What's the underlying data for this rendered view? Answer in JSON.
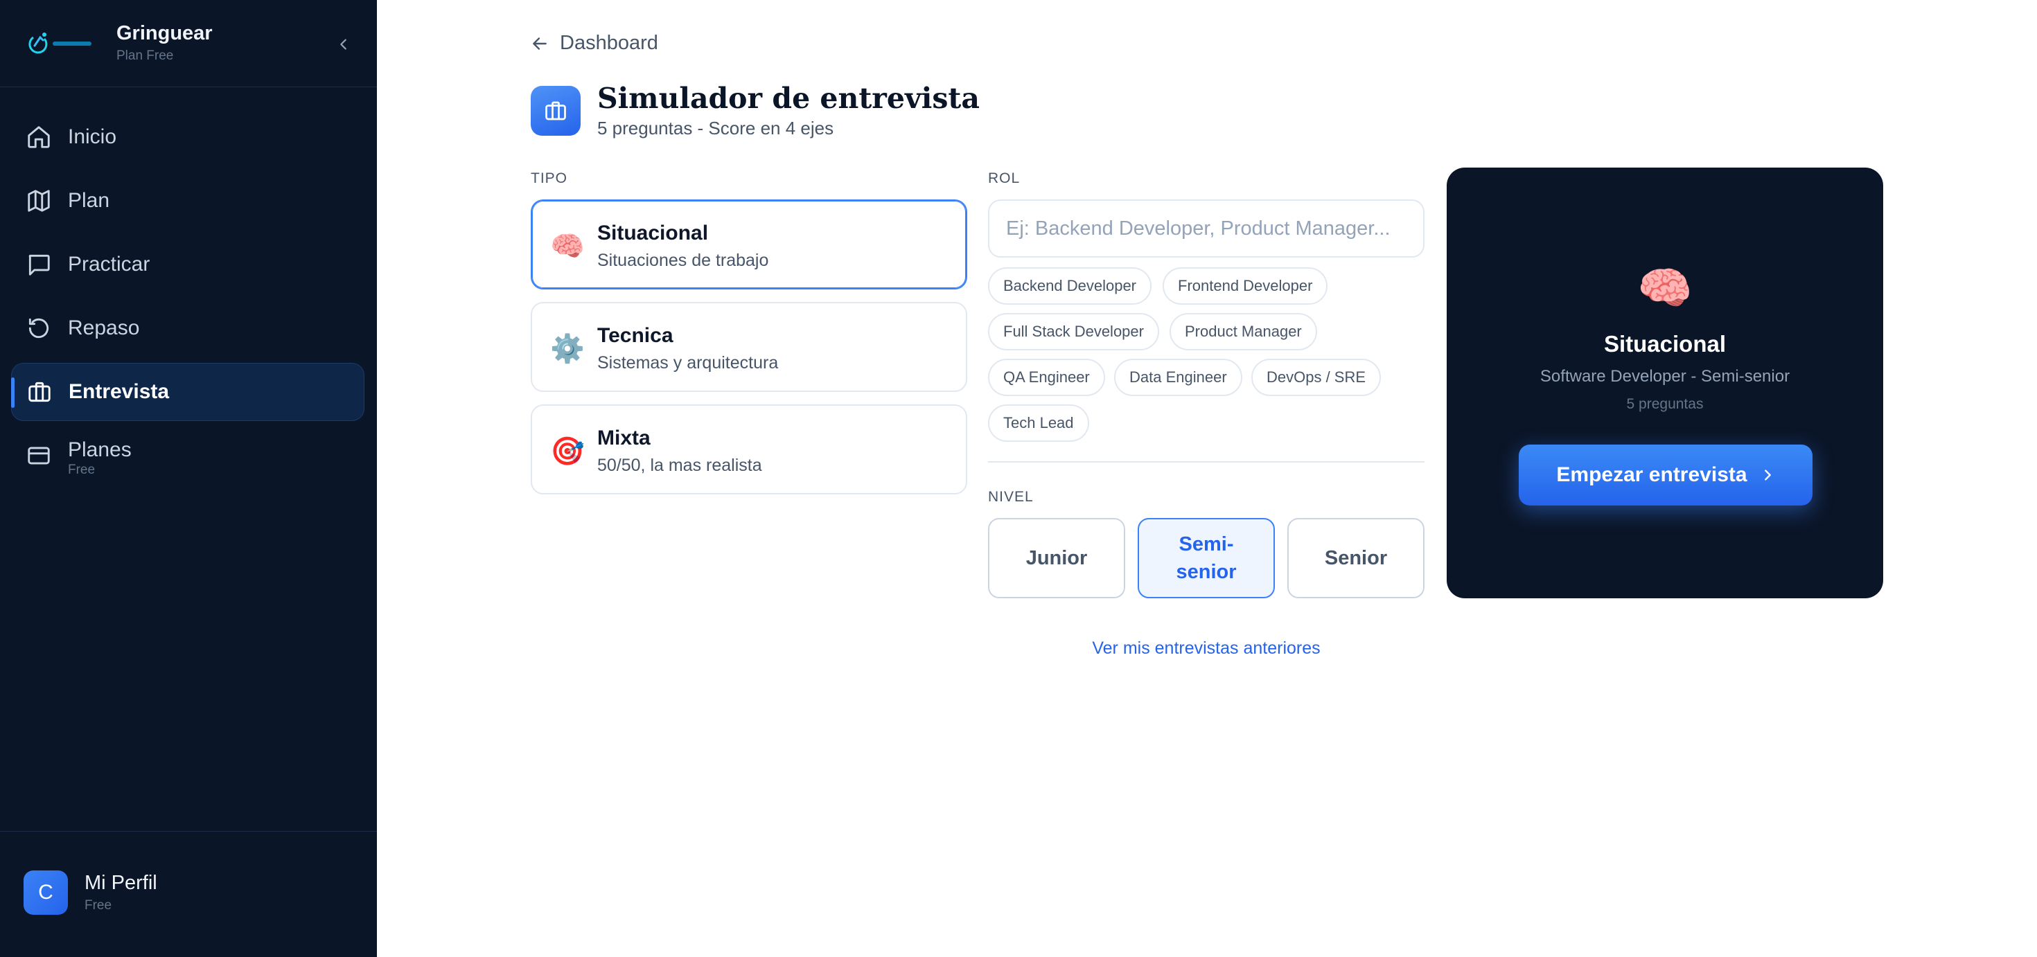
{
  "brand": {
    "name": "Gringuear",
    "plan": "Plan Free",
    "logo_text": "Gringuear"
  },
  "sidebar": {
    "items": [
      {
        "label": "Inicio",
        "icon": "home-icon"
      },
      {
        "label": "Plan",
        "icon": "map-icon"
      },
      {
        "label": "Practicar",
        "icon": "chat-icon"
      },
      {
        "label": "Repaso",
        "icon": "history-icon"
      },
      {
        "label": "Entrevista",
        "icon": "briefcase-icon",
        "active": true
      },
      {
        "label": "Planes",
        "sub": "Free",
        "icon": "credit-card-icon"
      }
    ]
  },
  "profile": {
    "initial": "C",
    "name": "Mi Perfil",
    "plan": "Free"
  },
  "header": {
    "back_label": "Dashboard",
    "title": "Simulador de entrevista",
    "subtitle": "5 preguntas - Score en 4 ejes"
  },
  "tipo": {
    "label": "TIPO",
    "options": [
      {
        "emoji": "🧠",
        "title": "Situacional",
        "desc": "Situaciones de trabajo",
        "selected": true
      },
      {
        "emoji": "⚙️",
        "title": "Tecnica",
        "desc": "Sistemas y arquitectura"
      },
      {
        "emoji": "🎯",
        "title": "Mixta",
        "desc": "50/50, la mas realista"
      }
    ]
  },
  "rol": {
    "label": "ROL",
    "placeholder": "Ej: Backend Developer, Product Manager...",
    "value": "",
    "chips": [
      "Backend Developer",
      "Frontend Developer",
      "Full Stack Developer",
      "Product Manager",
      "QA Engineer",
      "Data Engineer",
      "DevOps / SRE",
      "Tech Lead"
    ]
  },
  "nivel": {
    "label": "NIVEL",
    "options": [
      "Junior",
      "Semi-\nsenior",
      "Senior"
    ],
    "selected": "Semi-senior"
  },
  "history_link": "Ver mis entrevistas anteriores",
  "preview": {
    "emoji": "🧠",
    "title": "Situacional",
    "subtitle": "Software Developer - Semi-senior",
    "count": "5 preguntas",
    "button_label": "Empezar entrevista"
  },
  "colors": {
    "sidebar_bg": "#0b1528",
    "accent": "#3b82f6",
    "accent_dark": "#2563eb"
  }
}
